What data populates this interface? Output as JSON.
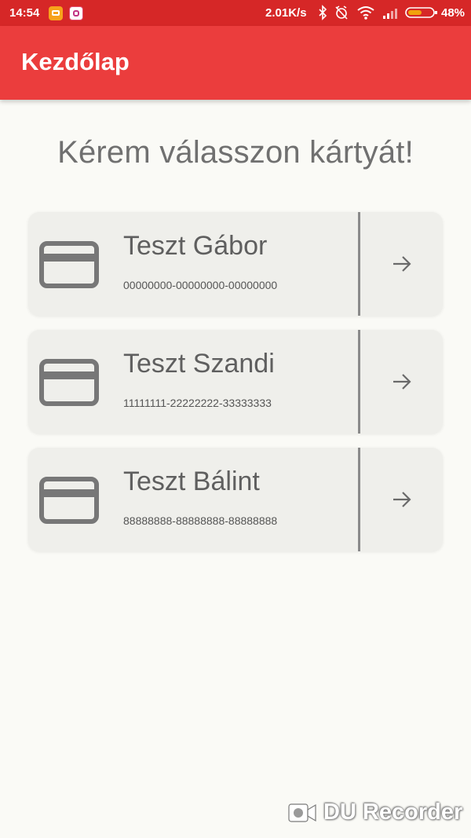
{
  "status_bar": {
    "time": "14:54",
    "network_speed": "2.01K/s",
    "battery": "48%",
    "notification_icons": [
      "app-notification-icon",
      "instagram-icon"
    ],
    "indicator_icons": [
      "bluetooth-icon",
      "silent-alarm-icon",
      "wifi-icon",
      "signal-icon",
      "battery-icon"
    ]
  },
  "app_bar": {
    "title": "Kezdőlap"
  },
  "heading": "Kérem válasszon kártyát!",
  "cards": [
    {
      "name": "Teszt Gábor",
      "number": "00000000-00000000-00000000",
      "icon": "credit-card-icon",
      "action_icon": "arrow-right-icon"
    },
    {
      "name": "Teszt Szandi",
      "number": "11111111-22222222-33333333",
      "icon": "credit-card-icon",
      "action_icon": "arrow-right-icon"
    },
    {
      "name": "Teszt Bálint",
      "number": "88888888-88888888-88888888",
      "icon": "credit-card-icon",
      "action_icon": "arrow-right-icon"
    }
  ],
  "watermark": {
    "text": "DU Recorder",
    "icon": "video-camera-icon"
  },
  "colors": {
    "status_bar": "#d62727",
    "app_bar": "#eb3d3d",
    "background": "#fafaf6",
    "card": "#efefeb",
    "card_text": "#5f5f5f"
  }
}
